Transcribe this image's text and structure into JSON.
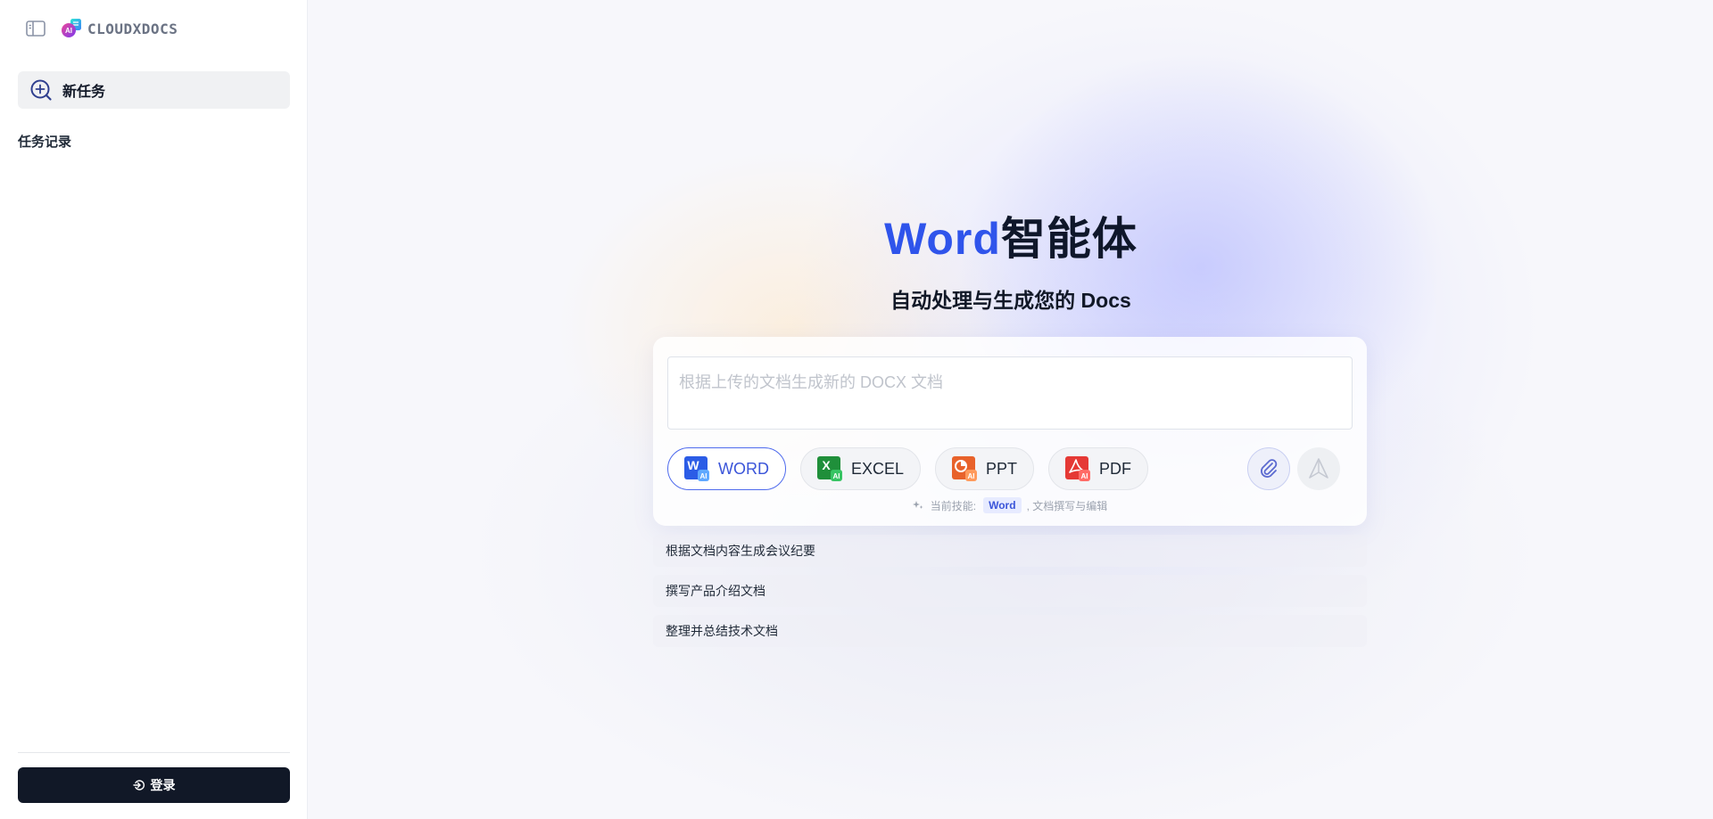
{
  "sidebar": {
    "logo_text": "CLOUDXDOCS",
    "new_task_label": "新任务",
    "history_title": "任务记录",
    "login_label": "登录"
  },
  "main": {
    "title_accent": "Word",
    "title_rest": "智能体",
    "subtitle": "自动处理与生成您的 Docs",
    "prompt_placeholder": "根据上传的文档生成新的 DOCX 文档",
    "skills": [
      {
        "label": "WORD",
        "icon": "word-icon",
        "color": "#2b5ce6",
        "active": true
      },
      {
        "label": "EXCEL",
        "icon": "excel-icon",
        "color": "#1f8f3a",
        "active": false
      },
      {
        "label": "PPT",
        "icon": "ppt-icon",
        "color": "#e8622b",
        "active": false
      },
      {
        "label": "PDF",
        "icon": "pdf-icon",
        "color": "#e53935",
        "active": false
      }
    ],
    "current_skill_prefix": "当前技能:",
    "current_skill_tag": "Word",
    "current_skill_desc": ", 文档撰写与编辑",
    "suggestions": [
      "根据文档内容生成会议纪要",
      "撰写产品介绍文档",
      "整理并总结技术文档"
    ]
  },
  "colors": {
    "accent": "#2f54eb",
    "login_bg": "#111827"
  }
}
